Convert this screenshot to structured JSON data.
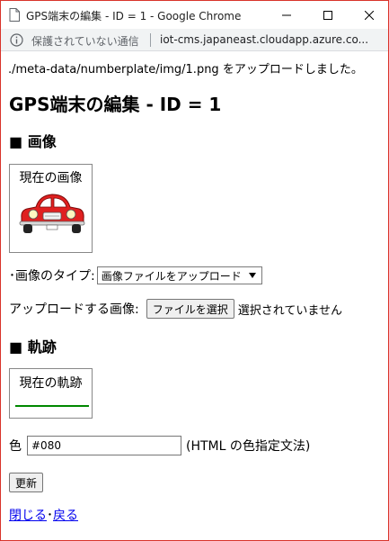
{
  "window": {
    "title": "GPS端末の編集 - ID = 1 - Google Chrome"
  },
  "addressbar": {
    "security_text": "保護されていない通信",
    "url": "iot-cms.japaneast.cloudapp.azure.co..."
  },
  "page": {
    "flash_message": "./meta-data/numberplate/img/1.png をアップロードしました。",
    "heading": "GPS端末の編集 - ID = 1",
    "section_image": "■ 画像",
    "current_image_caption": "現在の画像",
    "image_type_label": "･画像のタイプ:",
    "image_type_selected": "画像ファイルをアップロード",
    "upload_label": "アップロードする画像:",
    "choose_file_button": "ファイルを選択",
    "no_file_text": "選択されていません",
    "section_track": "■ 軌跡",
    "current_track_caption": "現在の軌跡",
    "track_color": "#008800",
    "color_label": "色",
    "color_value": "#080",
    "color_hint": "(HTML の色指定文法)",
    "update_button": "更新",
    "close_link": "閉じる",
    "link_separator": "･",
    "back_link": "戻る"
  }
}
